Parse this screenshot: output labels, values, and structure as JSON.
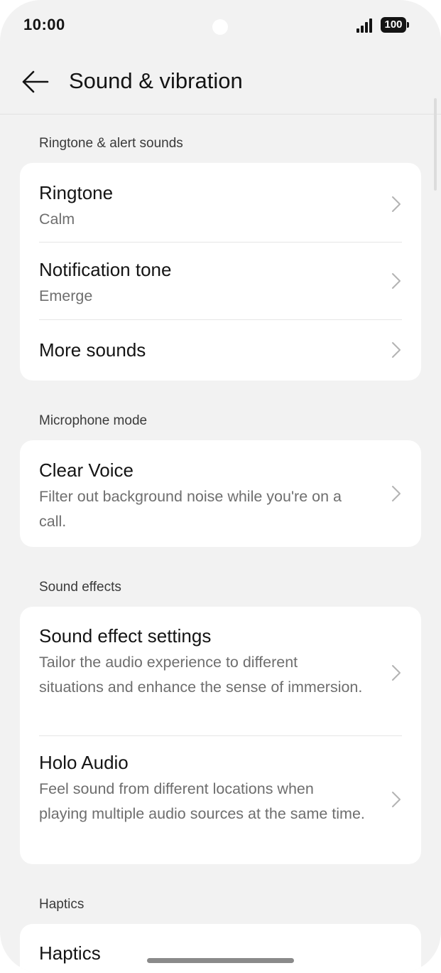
{
  "status": {
    "time": "10:00",
    "battery": "100"
  },
  "header": {
    "title": "Sound & vibration"
  },
  "sections": {
    "ringtone": {
      "label": "Ringtone & alert sounds",
      "items": [
        {
          "title": "Ringtone",
          "subtitle": "Calm"
        },
        {
          "title": "Notification tone",
          "subtitle": "Emerge"
        },
        {
          "title": "More sounds"
        }
      ]
    },
    "microphone": {
      "label": "Microphone mode",
      "items": [
        {
          "title": "Clear Voice",
          "subtitle": "Filter out background noise while you're on a call."
        }
      ]
    },
    "effects": {
      "label": "Sound effects",
      "items": [
        {
          "title": "Sound effect settings",
          "subtitle": "Tailor the audio experience to different situations and enhance the sense of immersion."
        },
        {
          "title": "Holo Audio",
          "subtitle": "Feel sound from different locations when playing multiple audio sources at the same time."
        }
      ]
    },
    "haptics": {
      "label": "Haptics",
      "items": [
        {
          "title": "Haptics"
        }
      ]
    }
  },
  "colors": {
    "background": "#f2f2f2",
    "card": "#ffffff",
    "secondary_text": "#6e6e6e"
  }
}
